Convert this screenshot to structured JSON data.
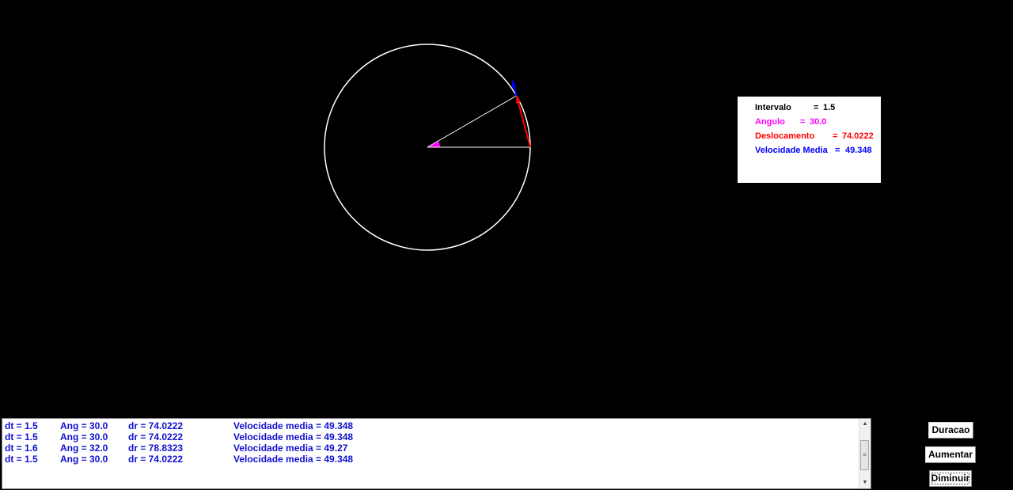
{
  "info_panel": {
    "intervalo": {
      "label": "Intervalo",
      "eq": "=",
      "value": "1.5",
      "color": "#000000"
    },
    "angulo": {
      "label": "Angulo",
      "eq": "=",
      "value": "30.0",
      "color": "#ff00ff"
    },
    "deslocamento": {
      "label": "Deslocamento",
      "eq": "=",
      "value": "74.0222",
      "color": "#ff0000"
    },
    "velocidade": {
      "label": "Velocidade Media",
      "eq": "=",
      "value": "49.348",
      "color": "#0000ff"
    }
  },
  "log": {
    "lines": [
      {
        "dt": "dt = 1.5",
        "ang": "Ang = 30.0",
        "dr": "dr = 74.0222",
        "vel": "Velocidade media = 49.348"
      },
      {
        "dt": "dt = 1.5",
        "ang": "Ang = 30.0",
        "dr": "dr = 74.0222",
        "vel": "Velocidade media = 49.348"
      },
      {
        "dt": "dt = 1.6",
        "ang": "Ang = 32.0",
        "dr": "dr = 78.8323",
        "vel": "Velocidade media = 49.27"
      },
      {
        "dt": "dt = 1.5",
        "ang": "Ang = 30.0",
        "dr": "dr = 74.0222",
        "vel": "Velocidade media = 49.348"
      }
    ],
    "color": "#1010d0"
  },
  "buttons": {
    "duracao": "Duracao",
    "aumentar": "Aumentar",
    "diminuir": "Diminuir"
  },
  "simulation": {
    "angle_deg": 30,
    "colors": {
      "circle": "#ffffff",
      "radius": "#ffffff",
      "angle_fill": "#ff00ff",
      "displacement": "#ff0000",
      "velocity": "#0000ff"
    }
  }
}
